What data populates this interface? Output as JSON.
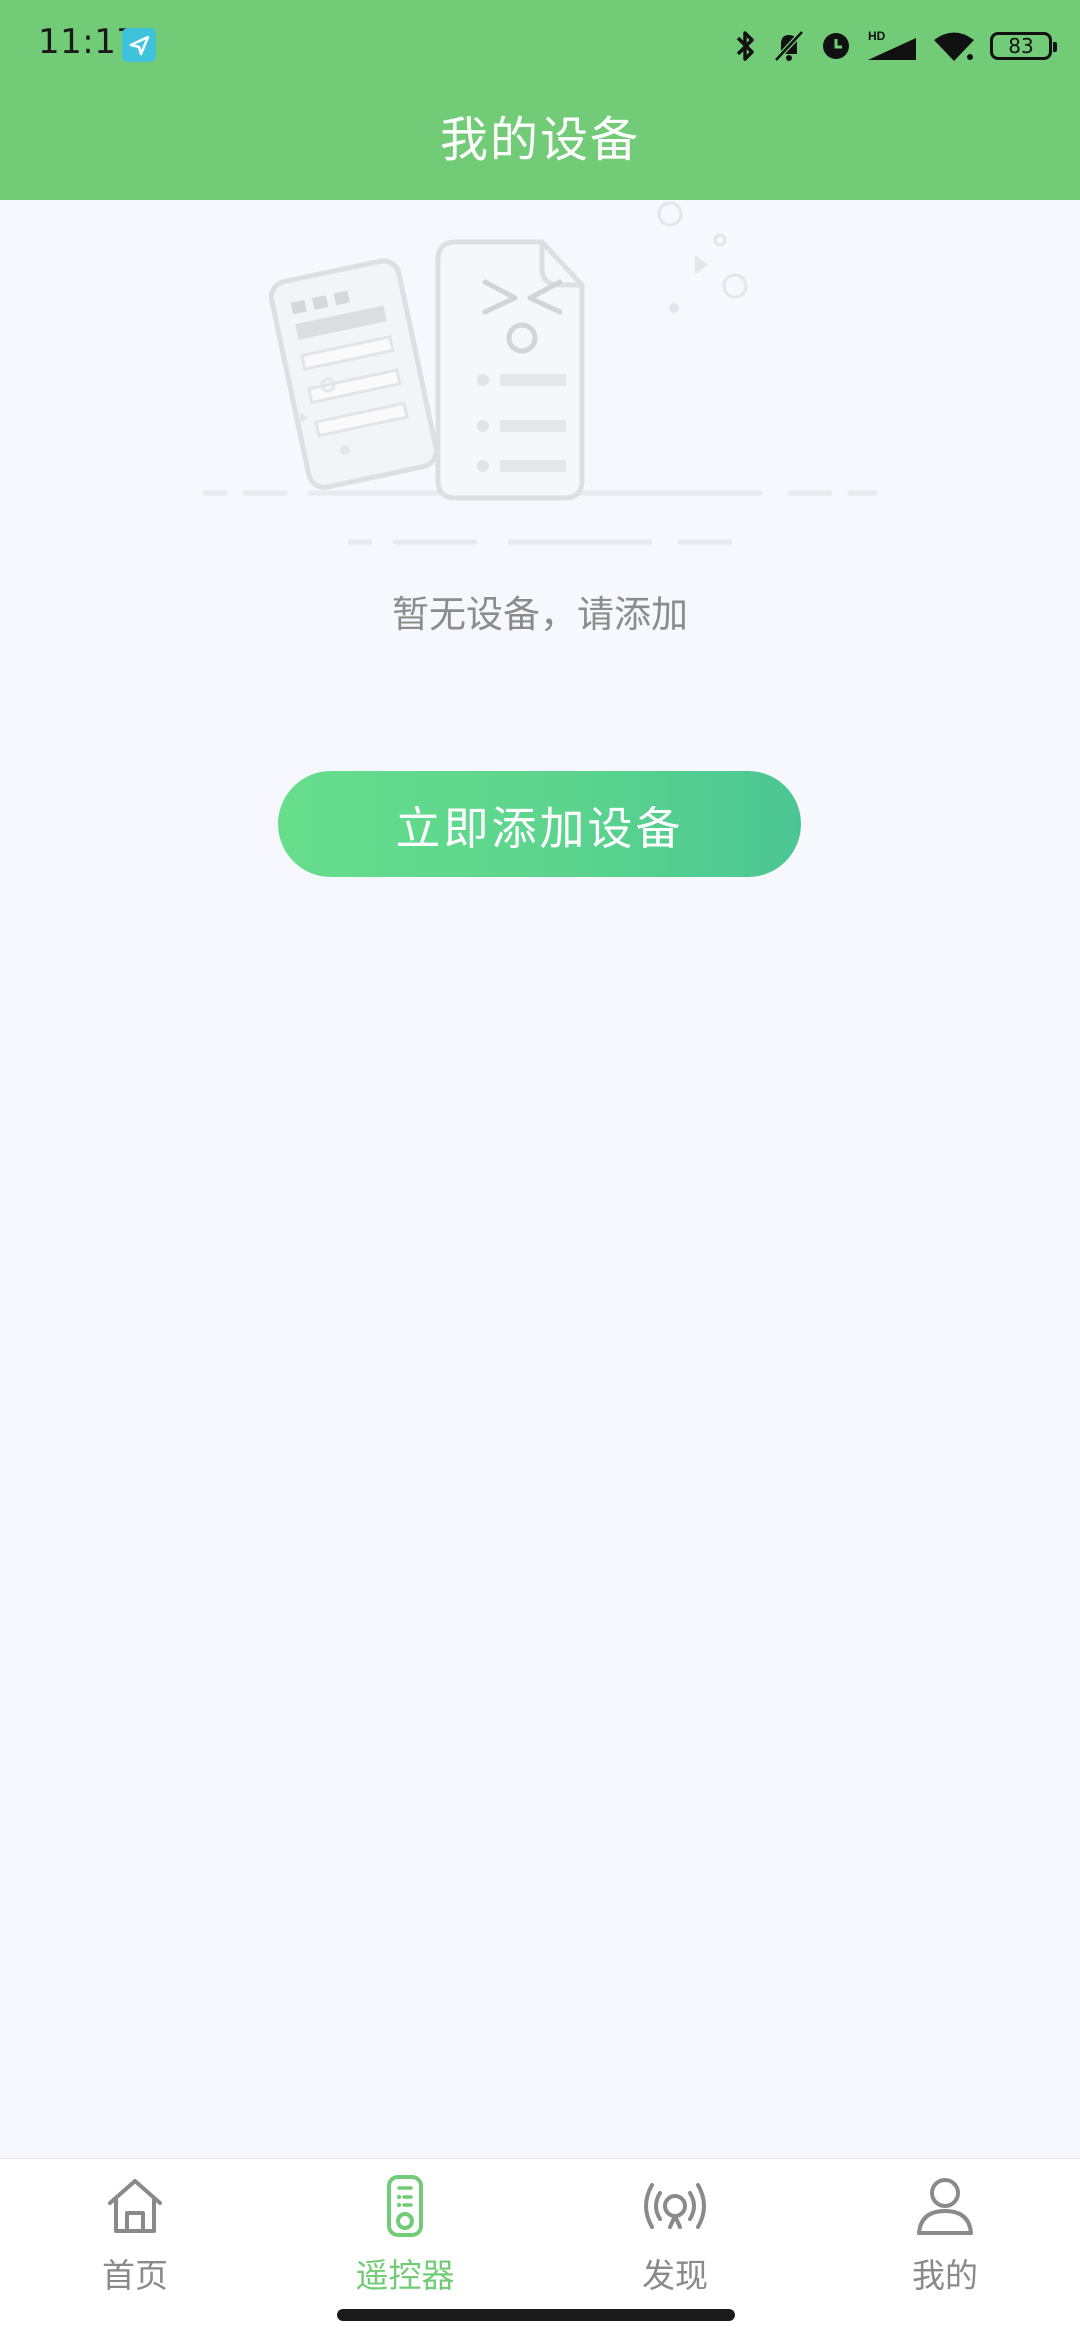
{
  "status_bar": {
    "time": "11:17",
    "battery": "83",
    "icons": [
      "navigation-app-icon",
      "bluetooth-icon",
      "mute-icon",
      "alarm-icon",
      "signal-hd-icon",
      "wifi-icon",
      "battery-icon"
    ],
    "signal_badge": "HD"
  },
  "header": {
    "title": "我的设备",
    "background_color": "#72cc77"
  },
  "empty_state": {
    "illustration": "empty-documents-illustration",
    "message": "暂无设备，请添加"
  },
  "add_button": {
    "label": "立即添加设备",
    "gradient": [
      "#66de8c",
      "#4bc693"
    ]
  },
  "tab_bar": {
    "active_color": "#72cc77",
    "inactive_color": "#8a8a8a",
    "tabs": [
      {
        "label": "首页",
        "icon": "home-icon",
        "active": false
      },
      {
        "label": "遥控器",
        "icon": "remote-control-icon",
        "active": true
      },
      {
        "label": "发现",
        "icon": "broadcast-icon",
        "active": false
      },
      {
        "label": "我的",
        "icon": "user-icon",
        "active": false
      }
    ]
  }
}
